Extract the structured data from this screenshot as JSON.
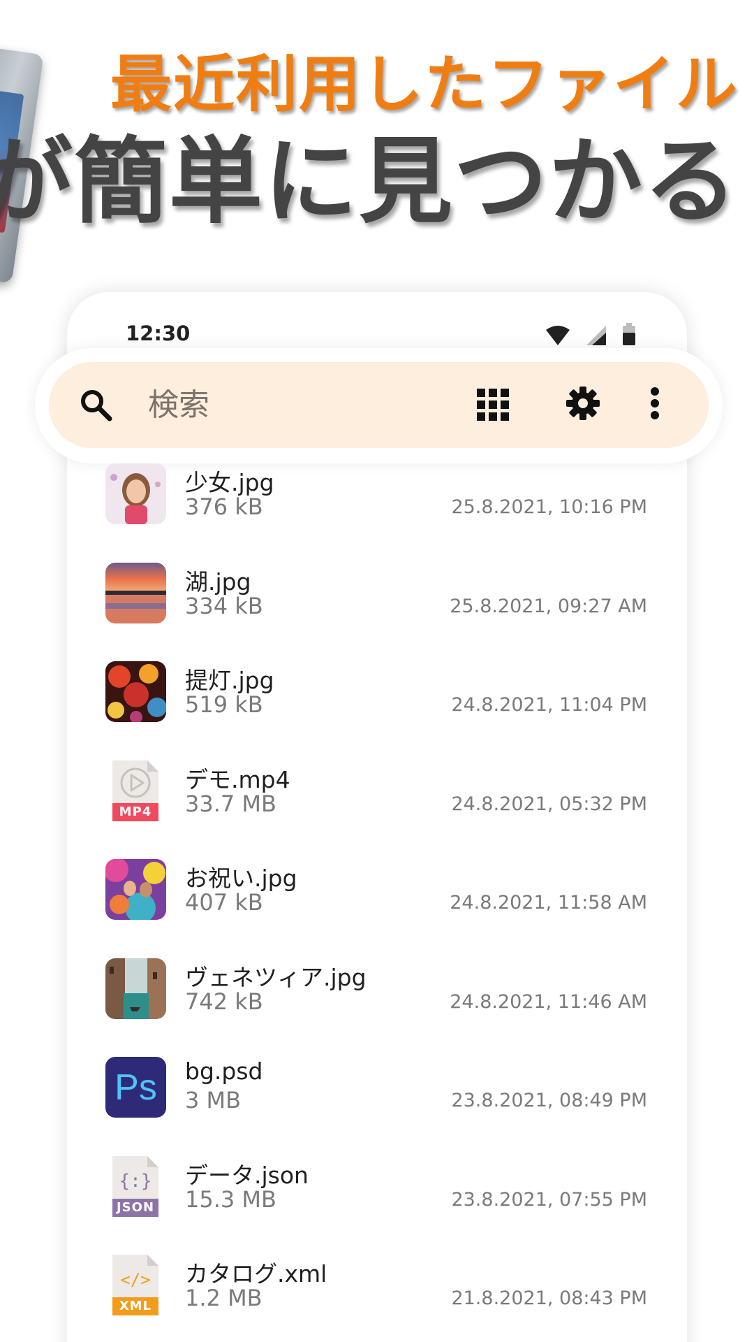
{
  "promo": {
    "line1": "最近利用したファイル",
    "line2": "が簡単に見つかる",
    "accent_color": "#f07d12",
    "dark_color": "#444444"
  },
  "status_bar": {
    "time": "12:30",
    "icons": [
      "wifi-icon",
      "signal-icon",
      "battery-icon"
    ]
  },
  "search": {
    "placeholder": "検索",
    "bar_color": "#fdeede",
    "icons": [
      "search-icon",
      "grid-view-icon",
      "gear-icon",
      "more-vert-icon"
    ]
  },
  "files": [
    {
      "name": "少女.jpg",
      "size": "376 kB",
      "date": "25.8.2021, 10:16 PM",
      "thumb": "photo-girl"
    },
    {
      "name": "湖.jpg",
      "size": "334 kB",
      "date": "25.8.2021, 09:27 AM",
      "thumb": "photo-lake"
    },
    {
      "name": "提灯.jpg",
      "size": "519 kB",
      "date": "24.8.2021, 11:04 PM",
      "thumb": "photo-lanterns"
    },
    {
      "name": "デモ.mp4",
      "size": "33.7 MB",
      "date": "24.8.2021, 05:32 PM",
      "thumb": "mp4-file-icon",
      "badge": "MP4",
      "badge_color": "#ef4a5e"
    },
    {
      "name": "お祝い.jpg",
      "size": "407 kB",
      "date": "24.8.2021, 11:58 AM",
      "thumb": "photo-celebration"
    },
    {
      "name": "ヴェネツィア.jpg",
      "size": "742 kB",
      "date": "24.8.2021, 11:46 AM",
      "thumb": "photo-venice"
    },
    {
      "name": "bg.psd",
      "size": "3 MB",
      "date": "23.8.2021, 08:49 PM",
      "thumb": "psd-file-icon",
      "badge": "Ps",
      "badge_color": "#2e2a78"
    },
    {
      "name": "データ.json",
      "size": "15.3 MB",
      "date": "23.8.2021, 07:55 PM",
      "thumb": "json-file-icon",
      "badge": "JSON",
      "badge_color": "#8e73a8"
    },
    {
      "name": "カタログ.xml",
      "size": "1.2 MB",
      "date": "21.8.2021, 08:43 PM",
      "thumb": "xml-file-icon",
      "badge": "XML",
      "badge_color": "#f39c1b"
    }
  ]
}
